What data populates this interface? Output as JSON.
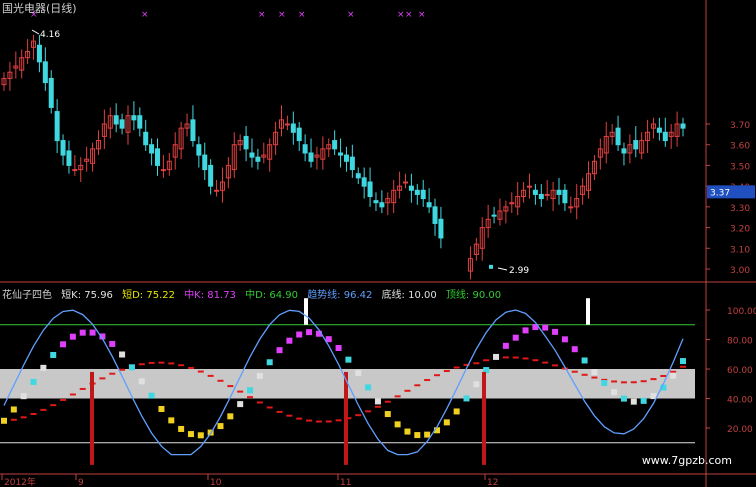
{
  "stock_title": "国光电器(日线)",
  "price_high_label": "4.16",
  "price_low_label": "2.99",
  "current_price": "3.37",
  "price_axis_ticks": [
    "3.70",
    "3.60",
    "3.50",
    "3.40",
    "3.30",
    "3.20",
    "3.10",
    "3.00"
  ],
  "indicator": {
    "name": "花仙子四色",
    "items": [
      {
        "label": "短K: 75.96",
        "color": "#e0e0e0"
      },
      {
        "label": "短D: 75.22",
        "color": "#e6e600"
      },
      {
        "label": "中K: 81.73",
        "color": "#e040fb"
      },
      {
        "label": "中D: 64.90",
        "color": "#33cc33"
      },
      {
        "label": "趋势线: 96.42",
        "color": "#5f9fff"
      },
      {
        "label": "底线: 10.00",
        "color": "#e0e0e0"
      },
      {
        "label": "顶线: 90.00",
        "color": "#33cc33"
      }
    ]
  },
  "indicator_axis_ticks": [
    "100.00",
    "80.00",
    "60.00",
    "40.00",
    "20.00"
  ],
  "date_labels": [
    "2012年",
    "9",
    "10",
    "11",
    "12"
  ],
  "watermark": "www.7gpzb.com",
  "colors": {
    "up": "#e04040",
    "down": "#40d8e0",
    "trend": "#5f9fff",
    "magenta": "#e040fb",
    "axis": "#c04040"
  }
}
